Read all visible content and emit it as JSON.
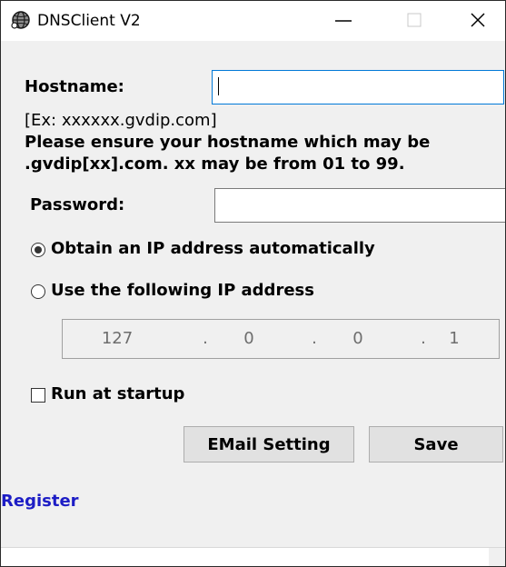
{
  "window": {
    "title": "DNSClient V2",
    "icon": "app-globe-icon",
    "controls": {
      "minimize": "minimize-icon",
      "maximize": "maximize-icon",
      "close": "close-icon"
    }
  },
  "form": {
    "hostname_label": "Hostname:",
    "hostname_value": "",
    "note_example": "[Ex: xxxxxx.gvdip.com]",
    "note_line2": "Please ensure your hostname which may be",
    "note_line3": ".gvdip[xx].com. xx may be from 01 to 99.",
    "password_label": "Password:",
    "password_value": "",
    "ip_mode": {
      "auto_label": "Obtain an IP address automatically",
      "manual_label": "Use the following IP address",
      "selected": "auto"
    },
    "ip_address": {
      "octet1": "127",
      "octet2": "0",
      "octet3": "0",
      "octet4": "1",
      "separator": "."
    },
    "run_at_startup_label": "Run at startup",
    "run_at_startup_checked": false
  },
  "buttons": {
    "email_setting": "EMail Setting",
    "save": "Save"
  },
  "links": {
    "register": "Register"
  },
  "colors": {
    "client_bg": "#f0f0f0",
    "focus_accent": "#0078d7",
    "link": "#1d1dc5"
  }
}
